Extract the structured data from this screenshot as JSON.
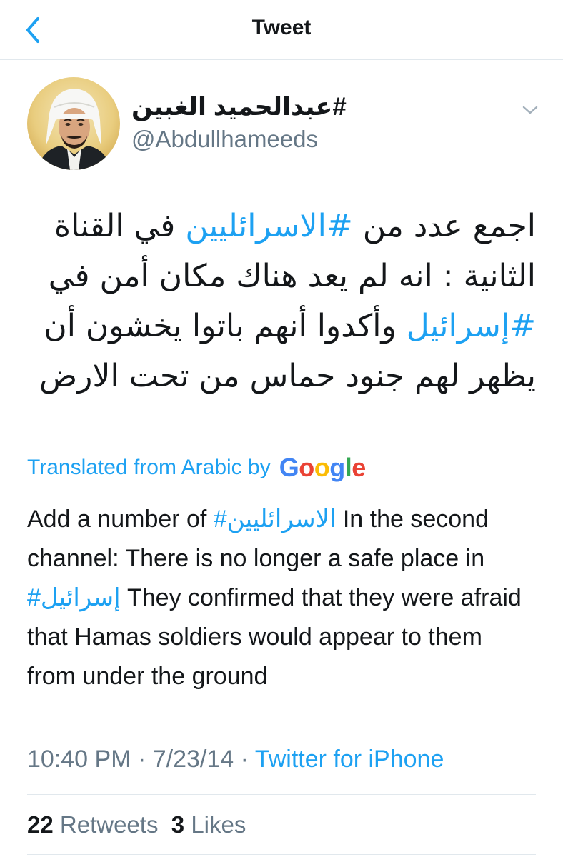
{
  "header": {
    "title": "Tweet",
    "back_icon": "chevron-left-icon",
    "accent_color": "#1da1f2"
  },
  "author": {
    "name": "#عبدالحميد الغبين",
    "handle": "@Abdullhameeds",
    "avatar_icon": "user-avatar"
  },
  "tweet": {
    "segments": [
      {
        "text": "اجمع عدد من ",
        "hashtag": false
      },
      {
        "text": "#الاسرائليين",
        "hashtag": true
      },
      {
        "text": " في القناة الثانية : انه لم يعد هناك مكان أمن في ",
        "hashtag": false
      },
      {
        "text": "#إسرائيل",
        "hashtag": true
      },
      {
        "text": " وأكدوا أنهم باتوا يخشون أن يظهر لهم جنود حماس من تحت الارض",
        "hashtag": false
      }
    ]
  },
  "translation": {
    "label": "Translated from Arabic by",
    "provider": "Google",
    "segments": [
      {
        "text": "Add a number of ",
        "hashtag": false
      },
      {
        "text": "#الاسرائليين",
        "hashtag": true
      },
      {
        "text": " In the second channel: There is no longer a safe place in ",
        "hashtag": false
      },
      {
        "text": "#إسرائيل",
        "hashtag": true
      },
      {
        "text": " They confirmed that they were afraid that Hamas soldiers would appear to them from under the ground",
        "hashtag": false
      }
    ]
  },
  "meta": {
    "time": "10:40 PM",
    "separator": " · ",
    "date": "7/23/14",
    "source": "Twitter for iPhone"
  },
  "stats": {
    "retweets_count": "22",
    "retweets_label": "Retweets",
    "likes_count": "3",
    "likes_label": "Likes"
  }
}
